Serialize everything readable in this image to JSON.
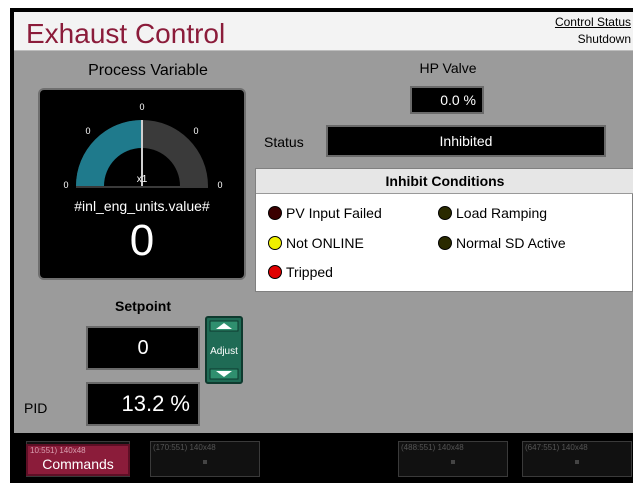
{
  "window": {
    "title": "Exhaust Control"
  },
  "control_status": {
    "label": "Control Status",
    "value": "Shutdown"
  },
  "process_variable": {
    "title": "Process Variable",
    "eng_units": "#inl_eng_units.value#",
    "value": "0",
    "gauge_multiplier": "x1",
    "gauge_level": 0.5
  },
  "hp_valve": {
    "title": "HP Valve",
    "value": "0.0 %"
  },
  "status": {
    "label": "Status",
    "value": "Inhibited"
  },
  "inhibit": {
    "title": "Inhibit Conditions",
    "conditions": [
      {
        "label": "PV Input Failed",
        "color": "#3a0000"
      },
      {
        "label": "Load Ramping",
        "color": "#2a2a00"
      },
      {
        "label": "Not ONLINE",
        "color": "#f0f000"
      },
      {
        "label": "Normal SD Active",
        "color": "#2a2a00"
      },
      {
        "label": "Tripped",
        "color": "#e00000"
      }
    ]
  },
  "setpoint": {
    "title": "Setpoint",
    "value": "0"
  },
  "adjust": {
    "label": "Adjust"
  },
  "pid": {
    "label": "PID",
    "value": "13.2 %"
  },
  "bottom": {
    "commands_label": "Commands",
    "slots": [
      "10:551) 140x48",
      "(170:551) 140x48",
      "(488:551) 140x48",
      "(647:551) 140x48"
    ]
  },
  "colors": {
    "accent": "#8b1c3a",
    "gauge_fill": "#1f7a8c",
    "adjust_green": "#1f6b55"
  }
}
